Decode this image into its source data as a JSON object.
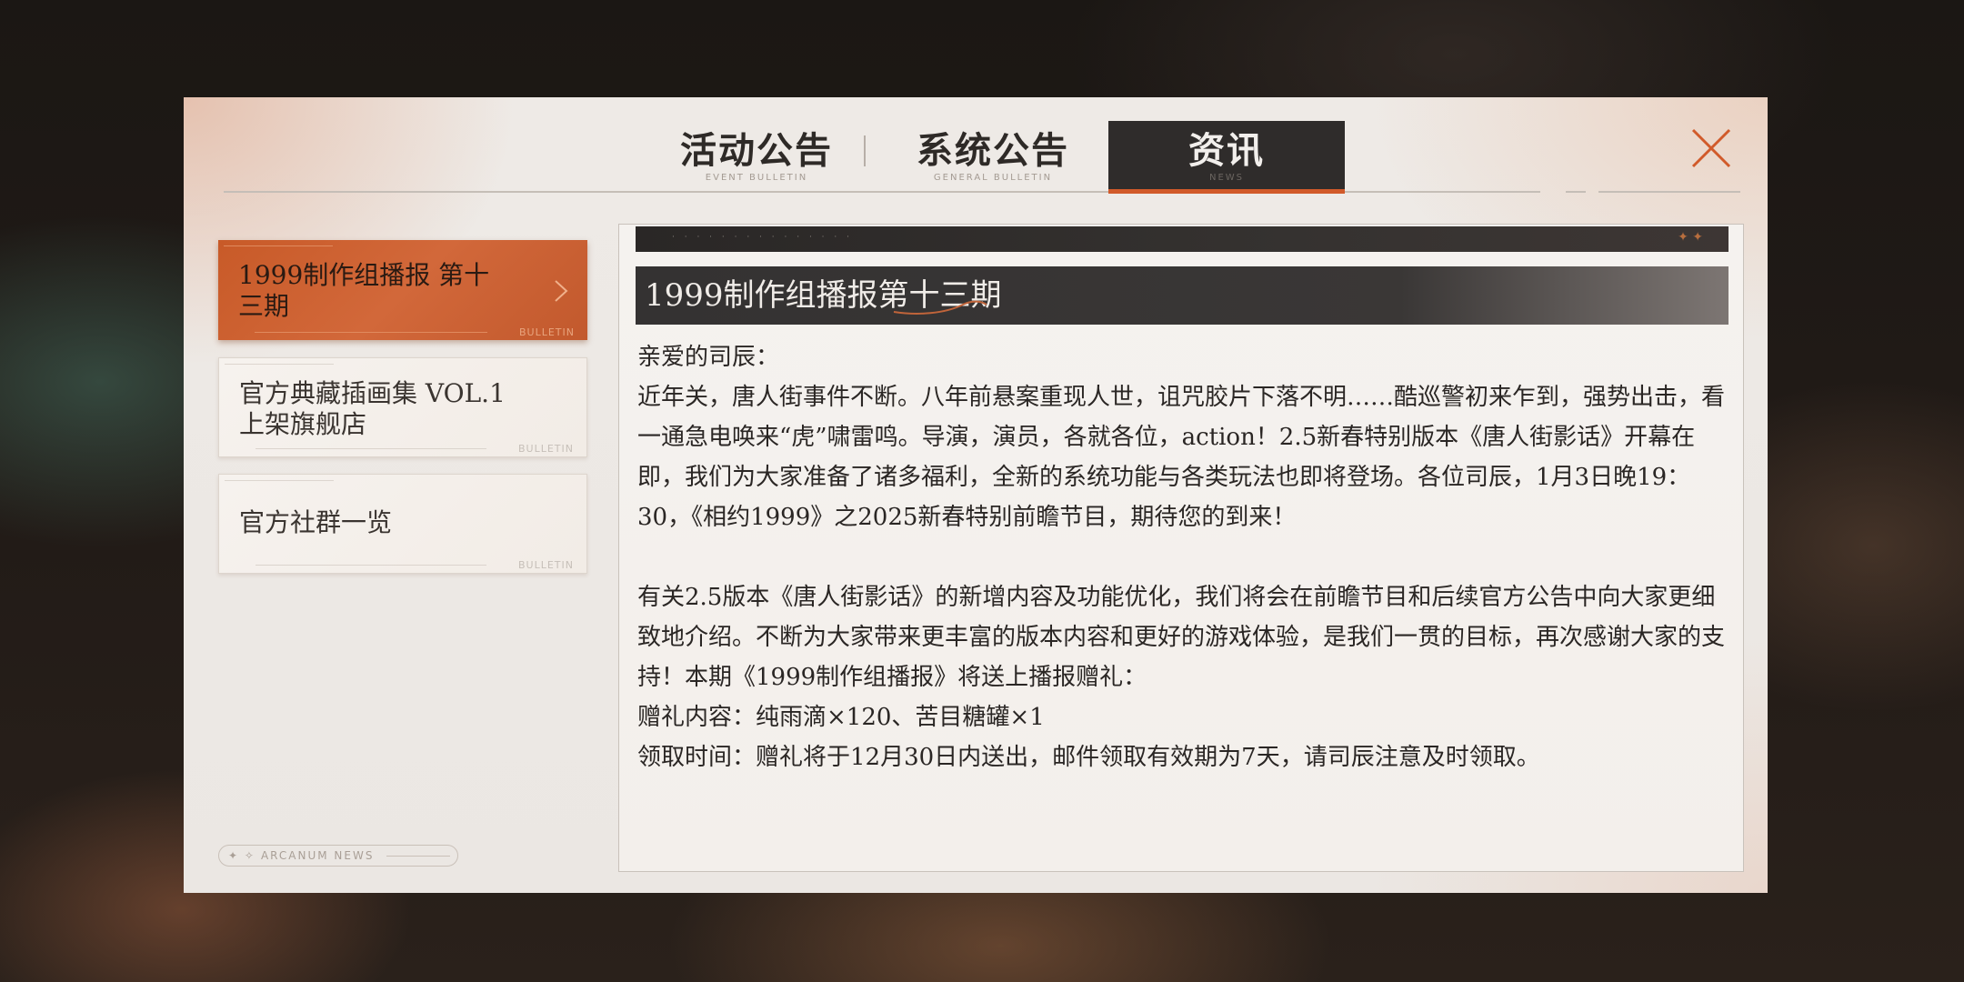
{
  "tabs": [
    {
      "label": "活动公告",
      "sub": "EVENT BULLETIN"
    },
    {
      "label": "系统公告",
      "sub": "GENERAL BULLETIN"
    },
    {
      "label": "资讯",
      "sub": "NEWS"
    }
  ],
  "active_tab": "资讯",
  "list": {
    "items": [
      {
        "title": "1999制作组播报 第十三期",
        "tag": "BULLETIN",
        "selected": true
      },
      {
        "title": "官方典藏插画集 VOL.1上架旗舰店",
        "tag": "BULLETIN",
        "selected": false
      },
      {
        "title": "官方社群一览",
        "tag": "BULLETIN",
        "selected": false
      }
    ]
  },
  "footer_badge": "ARCANUM NEWS",
  "article": {
    "title": "1999制作组播报第十三期",
    "paragraphs": [
      "亲爱的司辰：",
      "近年关，唐人街事件不断。八年前悬案重现人世，诅咒胶片下落不明……酷巡警初来乍到，强势出击，看一通急电唤来“虎”啸雷鸣。导演，演员，各就各位，action！2.5新春特别版本《唐人街影话》开幕在即，我们为大家准备了诸多福利，全新的系统功能与各类玩法也即将登场。各位司辰，1月3日晚19：30，《相约1999》之2025新春特别前瞻节目，期待您的到来！",
      "",
      "有关2.5版本《唐人街影话》的新增内容及功能优化，我们将会在前瞻节目和后续官方公告中向大家更细致地介绍。不断为大家带来更丰富的版本内容和更好的游戏体验，是我们一贯的目标，再次感谢大家的支持！本期《1999制作组播报》将送上播报赠礼：",
      "赠礼内容：纯雨滴×120、苦目糖罐×1",
      "领取时间：赠礼将于12月30日内送出，邮件领取有效期为7天，请司辰注意及时领取。"
    ]
  },
  "colors": {
    "accent": "#d15a2a",
    "tab_active_bg": "#2f2c2b",
    "selected_item": "#c85a28"
  }
}
